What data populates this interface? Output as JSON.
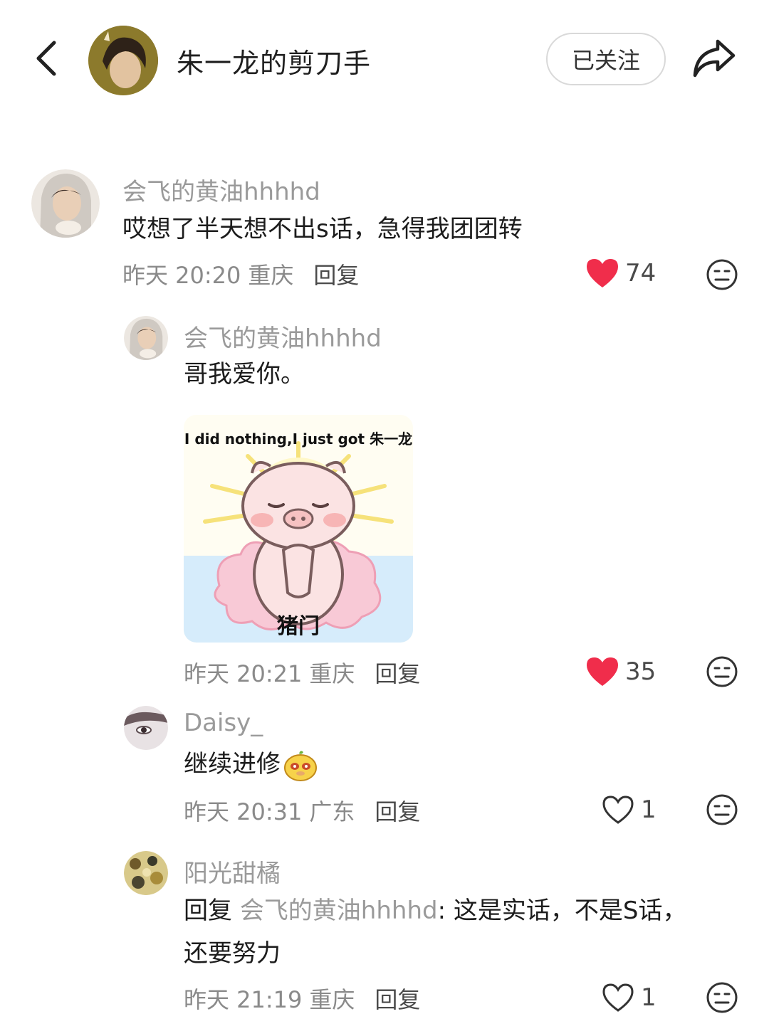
{
  "header": {
    "title": "朱一龙的剪刀手",
    "follow_label": "已关注"
  },
  "comments": [
    {
      "name": "会飞的黄油hhhhd",
      "content": "哎想了半天想不出s话，急得我团团转",
      "time": "昨天 20:20",
      "location": "重庆",
      "reply": "回复",
      "likes": "74",
      "liked": true
    },
    {
      "name": "会飞的黄油hhhhd",
      "content": "哥我爱你。",
      "meme_top": "I did nothing,I just got 朱一龙",
      "meme_bottom": "猪门",
      "time": "昨天 20:21",
      "location": "重庆",
      "reply": "回复",
      "likes": "35",
      "liked": true
    },
    {
      "name": "Daisy_",
      "content": "继续进修",
      "time": "昨天 20:31",
      "location": "广东",
      "reply": "回复",
      "likes": "1",
      "liked": false
    },
    {
      "name": "阳光甜橘",
      "reply_prefix": "回复",
      "reply_to": "会飞的黄油hhhhd",
      "content_line1": ": 这是实话，不是S话，",
      "content_line2": "还要努力",
      "time": "昨天 21:19",
      "location": "重庆",
      "reply": "回复",
      "likes": "1",
      "liked": false
    }
  ],
  "colors": {
    "like_red": "#f02d4b",
    "muted": "#9a9a9a"
  }
}
